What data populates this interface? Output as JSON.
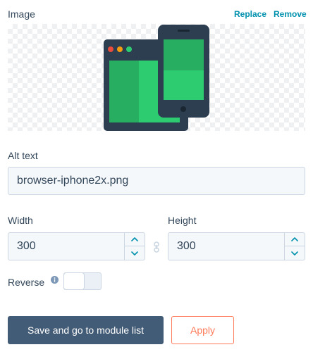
{
  "image_section": {
    "label": "Image",
    "replace_label": "Replace",
    "remove_label": "Remove"
  },
  "alt_text": {
    "label": "Alt text",
    "value": "browser-iphone2x.png"
  },
  "width": {
    "label": "Width",
    "value": "300"
  },
  "height": {
    "label": "Height",
    "value": "300"
  },
  "reverse": {
    "label": "Reverse",
    "enabled": false
  },
  "buttons": {
    "save_label": "Save and go to module list",
    "apply_label": "Apply"
  },
  "colors": {
    "link": "#0091ae",
    "primary_button": "#425b76",
    "apply_accent": "#ff7a59",
    "text": "#33475b",
    "input_bg": "#f5f8fa",
    "input_border": "#cbd6e2"
  },
  "icons": {
    "info": "info-icon",
    "lock": "link-lock-icon",
    "up": "chevron-up-icon",
    "down": "chevron-down-icon"
  }
}
